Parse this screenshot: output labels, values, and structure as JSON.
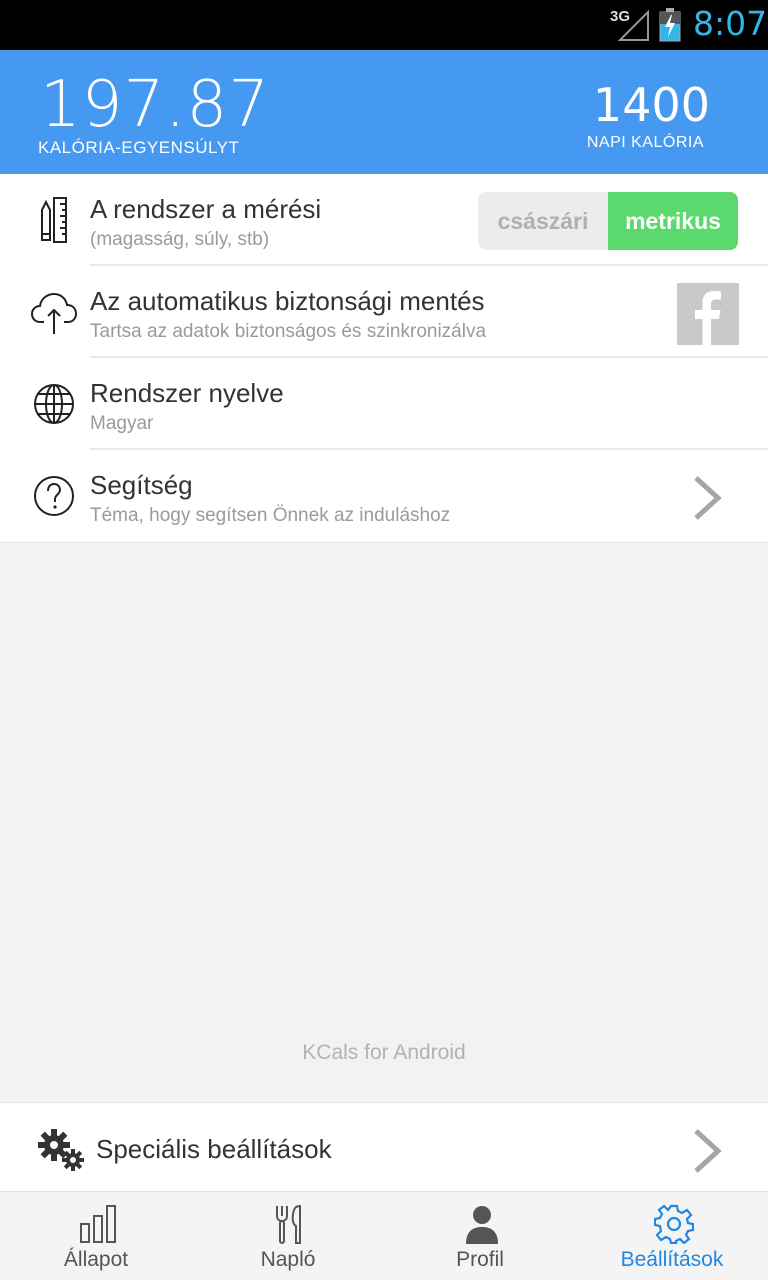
{
  "status_bar": {
    "network": "3G",
    "time": "8:07"
  },
  "header": {
    "balance_value": "197.87",
    "balance_label": "KALÓRIA-EGYENSÚLYT",
    "daily_value": "1400",
    "daily_label": "NAPI KALÓRIA"
  },
  "settings": {
    "measurement": {
      "title": "A rendszer a mérési",
      "subtitle": "(magasság, súly, stb)",
      "imperial_label": "császári",
      "metric_label": "metrikus",
      "selected": "metrikus"
    },
    "backup": {
      "title": "Az automatikus biztonsági mentés",
      "subtitle": "Tartsa az adatok biztonságos és szinkronizálva"
    },
    "language": {
      "title": "Rendszer nyelve",
      "subtitle": "Magyar"
    },
    "help": {
      "title": "Segítség",
      "subtitle": "Téma, hogy segítsen Önnek az induláshoz"
    }
  },
  "footer_text": "KCals for Android",
  "special": {
    "title": "Speciális beállítások"
  },
  "bottom_nav": {
    "items": [
      {
        "label": "Állapot",
        "icon": "bar-chart-icon",
        "active": false
      },
      {
        "label": "Napló",
        "icon": "fork-knife-icon",
        "active": false
      },
      {
        "label": "Profil",
        "icon": "person-icon",
        "active": false
      },
      {
        "label": "Beállítások",
        "icon": "gear-icon",
        "active": true
      }
    ]
  },
  "colors": {
    "header_bg": "#4599f0",
    "metric_active": "#5bd96f",
    "nav_active": "#1e88e5",
    "status_time": "#33b5e5"
  }
}
